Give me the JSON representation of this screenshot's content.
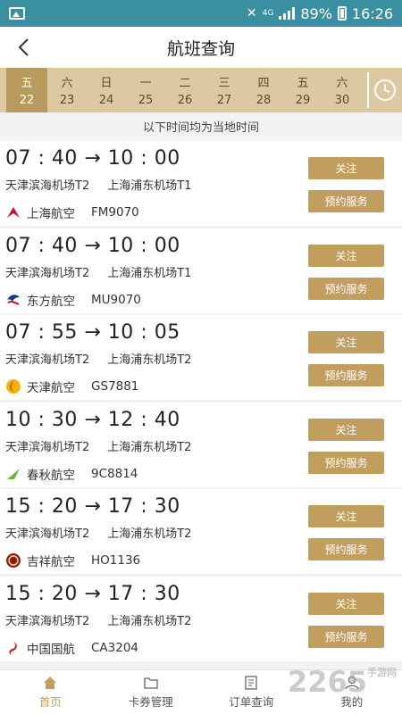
{
  "statusbar": {
    "network": "4G",
    "battery": "89%",
    "time": "16:26"
  },
  "header": {
    "title": "航班查询"
  },
  "dates": [
    {
      "weekday": "五",
      "day": "22",
      "selected": true
    },
    {
      "weekday": "六",
      "day": "23"
    },
    {
      "weekday": "日",
      "day": "24"
    },
    {
      "weekday": "一",
      "day": "25"
    },
    {
      "weekday": "二",
      "day": "26"
    },
    {
      "weekday": "三",
      "day": "27"
    },
    {
      "weekday": "四",
      "day": "28"
    },
    {
      "weekday": "五",
      "day": "29"
    },
    {
      "weekday": "六",
      "day": "30"
    }
  ],
  "tz_note": "以下时间均为当地时间",
  "buttons": {
    "follow": "关注",
    "book": "预约服务"
  },
  "flights": [
    {
      "times": "07 : 40 → 10 : 00",
      "dep": "天津滨海机场T2",
      "arr": "上海浦东机场T1",
      "airline": "上海航空",
      "flight_no": "FM9070",
      "logo_color": "#c8102e",
      "logo_icon": "shanghai-airlines-logo"
    },
    {
      "times": "07 : 40 → 10 : 00",
      "dep": "天津滨海机场T2",
      "arr": "上海浦东机场T1",
      "airline": "东方航空",
      "flight_no": "MU9070",
      "logo_color": "#1b3a8c",
      "logo_icon": "china-eastern-logo"
    },
    {
      "times": "07 : 55 → 10 : 05",
      "dep": "天津滨海机场T2",
      "arr": "上海浦东机场T2",
      "airline": "天津航空",
      "flight_no": "GS7881",
      "logo_color": "#e03020",
      "logo_icon": "tianjin-airlines-logo"
    },
    {
      "times": "10 : 30 → 12 : 40",
      "dep": "天津滨海机场T2",
      "arr": "上海浦东机场T2",
      "airline": "春秋航空",
      "flight_no": "9C8814",
      "logo_color": "#6cb33e",
      "logo_icon": "spring-airlines-logo"
    },
    {
      "times": "15 : 20 → 17 : 30",
      "dep": "天津滨海机场T2",
      "arr": "上海浦东机场T2",
      "airline": "吉祥航空",
      "flight_no": "HO1136",
      "logo_color": "#8b1a1a",
      "logo_icon": "juneyao-airlines-logo"
    },
    {
      "times": "15 : 20 → 17 : 30",
      "dep": "天津滨海机场T2",
      "arr": "上海浦东机场T2",
      "airline": "中国国航",
      "flight_no": "CA3204",
      "logo_color": "#d7141a",
      "logo_icon": "air-china-logo"
    }
  ],
  "tabs": [
    {
      "label": "首页",
      "icon": "home-icon",
      "active": true
    },
    {
      "label": "卡券管理",
      "icon": "folder-icon"
    },
    {
      "label": "订单查询",
      "icon": "order-icon"
    },
    {
      "label": "我的",
      "icon": "user-icon"
    }
  ],
  "watermark": "2265",
  "watermark_sub": "手游网",
  "colors": {
    "accent": "#c19d5e",
    "statusbar": "#3a8fa0",
    "datebar": "#dcc9a1",
    "date_selected": "#b99a5e"
  }
}
